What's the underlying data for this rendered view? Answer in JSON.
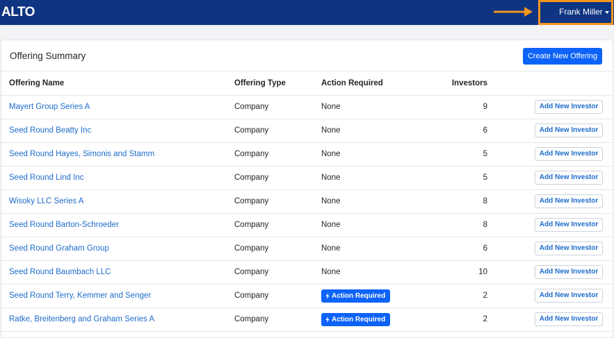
{
  "app": {
    "logo": "ALTO",
    "user_name": "Frank Miller"
  },
  "colors": {
    "navbar": "#0e3482",
    "accent": "#0d63f8",
    "highlight": "#f5951f",
    "link": "#1d6ccc"
  },
  "card": {
    "title": "Offering Summary",
    "create_label": "Create New Offering"
  },
  "table": {
    "columns": [
      "Offering Name",
      "Offering Type",
      "Action Required",
      "Investors",
      ""
    ],
    "add_label": "Add New Investor",
    "rows": [
      {
        "name": "Mayert Group Series A",
        "type": "Company",
        "action": "None",
        "investors": "9"
      },
      {
        "name": "Seed Round Beatty Inc",
        "type": "Company",
        "action": "None",
        "investors": "6"
      },
      {
        "name": "Seed Round Hayes, Simonis and Stamm",
        "type": "Company",
        "action": "None",
        "investors": "5"
      },
      {
        "name": "Seed Round Lind Inc",
        "type": "Company",
        "action": "None",
        "investors": "5"
      },
      {
        "name": "Wisoky LLC Series A",
        "type": "Company",
        "action": "None",
        "investors": "8"
      },
      {
        "name": "Seed Round Barton-Schroeder",
        "type": "Company",
        "action": "None",
        "investors": "8"
      },
      {
        "name": "Seed Round Graham Group",
        "type": "Company",
        "action": "None",
        "investors": "6"
      },
      {
        "name": "Seed Round Baumbach LLC",
        "type": "Company",
        "action": "None",
        "investors": "10"
      },
      {
        "name": "Seed Round Terry, Kemmer and Senger",
        "type": "Company",
        "action": "Action Required",
        "investors": "2"
      },
      {
        "name": "Ratke, Breitenberg and Graham Series A",
        "type": "Company",
        "action": "Action Required",
        "investors": "2"
      }
    ]
  }
}
